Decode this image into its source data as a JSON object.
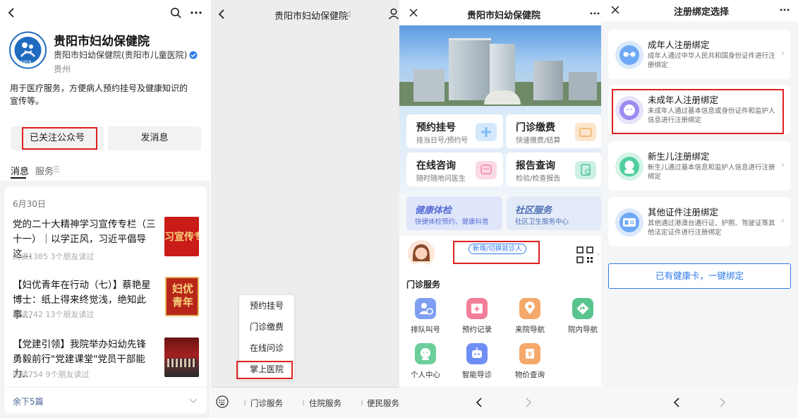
{
  "panel1": {
    "name": "贵阳市妇幼保健院",
    "subtitle": "贵阳市妇幼保健院(贵阳市儿童医院)",
    "region": "贵州",
    "logo_year": "1958",
    "description": "用于医疗服务，方便病人预约挂号及健康知识的宣传等。",
    "followed_button": "已关注公众号",
    "message_button": "发消息",
    "tabs": [
      "消息",
      "服务"
    ],
    "date": "6月30日",
    "articles": [
      {
        "title": "党的二十大精神学习宣传专栏（三十一）｜以学正风，习近平倡导这…",
        "meta": "阅读1385 3个朋友读过",
        "thumb_text": "习宣传专"
      },
      {
        "title": "【妇优青年在行动（七）】蔡艳星博士：纸上得来终觉浅，绝知此事…",
        "meta": "阅读742 13个朋友读过",
        "thumb_text": "妇优青年"
      },
      {
        "title": "【党建引领】我院举办妇幼先锋 勇毅前行\"党建课堂\"党员干部能力…",
        "meta": "阅读754 9个朋友读过",
        "thumb_text": ""
      }
    ],
    "remaining": "余下5篇"
  },
  "panel2": {
    "title": "贵阳市妇幼保健院",
    "menu": [
      "预约挂号",
      "门诊缴费",
      "在线问诊",
      "掌上医院"
    ],
    "bottom_tabs": [
      "门诊服务",
      "住院服务",
      "便民服务"
    ]
  },
  "panel3": {
    "title": "贵阳市妇幼保健院",
    "services": [
      {
        "title": "预约挂号",
        "sub": "挂当日号/预约号",
        "color": "#6fb6f5"
      },
      {
        "title": "门诊缴费",
        "sub": "快速缴费/结算",
        "color": "#f5b66f"
      },
      {
        "title": "在线咨询",
        "sub": "随时随地问医生",
        "color": "#f58fb4"
      },
      {
        "title": "报告查询",
        "sub": "检验/检查报告",
        "color": "#5cc7a8"
      }
    ],
    "banners": [
      {
        "title": "健康体检",
        "sub": "快捷体检预约、健康科普",
        "color": "#5b6fd6",
        "bg": "#dfe6fb"
      },
      {
        "title": "社区服务",
        "sub": "社区卫生服务中心",
        "color": "#4d6fb5",
        "bg": "#e3eaf8"
      }
    ],
    "switch_patient": "新增/切换就诊人",
    "section_title": "门诊服务",
    "grid": [
      {
        "label": "排队叫号",
        "color": "#7e9ff2"
      },
      {
        "label": "预约记录",
        "color": "#f27f9a"
      },
      {
        "label": "来院导航",
        "color": "#f4a86a"
      },
      {
        "label": "院内导航",
        "color": "#59c48e"
      },
      {
        "label": "个人中心",
        "color": "#6ccf9b"
      },
      {
        "label": "智能导诊",
        "color": "#6f8ef5"
      },
      {
        "label": "物价查询",
        "color": "#f4a86a"
      }
    ]
  },
  "panel4": {
    "title": "注册绑定选择",
    "options": [
      {
        "title": "成年人注册绑定",
        "desc": "成年人通过中华人民共和国身份证件进行注册绑定",
        "color": "#6ea9f5"
      },
      {
        "title": "未成年人注册绑定",
        "desc": "未成年人通过基本信息或身份证件和监护人信息进行注册绑定",
        "color": "#9a8cf0"
      },
      {
        "title": "新生儿注册绑定",
        "desc": "新生儿通过基本信息和监护人信息进行注册绑定",
        "color": "#4fcf9e"
      },
      {
        "title": "其他证件注册绑定",
        "desc": "其他通过港澳台通行证、护照、驾驶证等其他法定证件进行注册绑定",
        "color": "#6ea9f5"
      }
    ],
    "bind_button": "已有健康卡，一键绑定"
  },
  "colors": {
    "accent_blue": "#2e7bea",
    "highlight_red": "#e02020"
  }
}
